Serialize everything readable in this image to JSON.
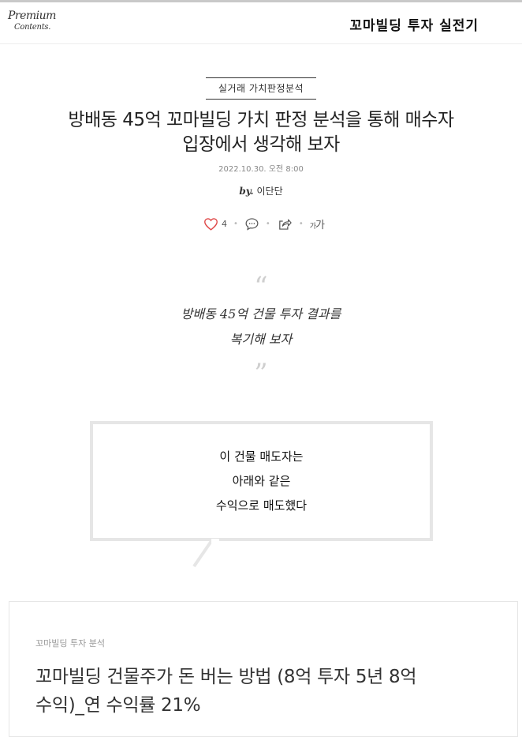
{
  "header": {
    "logo_line1": "Premium",
    "logo_line2": "Contents.",
    "series_title": "꼬마빌딩 투자 실전기"
  },
  "article": {
    "category": "실거래 가치판정분석",
    "title_line1": "방배동 45억 꼬마빌딩 가치 판정 분석을 통해 매수자",
    "title_line2": "입장에서 생각해 보자",
    "date": "2022.10.30. 오전 8:00",
    "by_label": "by.",
    "author": "이단단"
  },
  "actions": {
    "like_count": "4",
    "font_size_label_small": "가",
    "font_size_label_large": "가"
  },
  "quote": {
    "open_mark": "“",
    "close_mark": "”",
    "line1": "방배동 45억 건물 투자 결과를",
    "line2": "복기해 보자"
  },
  "bubble": {
    "line1": "이 건물 매도자는",
    "line2": "아래와 같은",
    "line3": "수익으로 매도했다"
  },
  "card": {
    "category": "꼬마빌딩 투자 분석",
    "title_line1": "꼬마빌딩 건물주가 돈 버는 방법 (8억 투자 5년 8억",
    "title_line2": "수익)_연 수익률 21%"
  },
  "colors": {
    "like_heart": "#e04b4b",
    "quote_mark": "#cfcfcf",
    "bubble_border": "#e6e6e6"
  },
  "icons": [
    "heart-icon",
    "comment-icon",
    "share-icon",
    "font-size-icon"
  ]
}
